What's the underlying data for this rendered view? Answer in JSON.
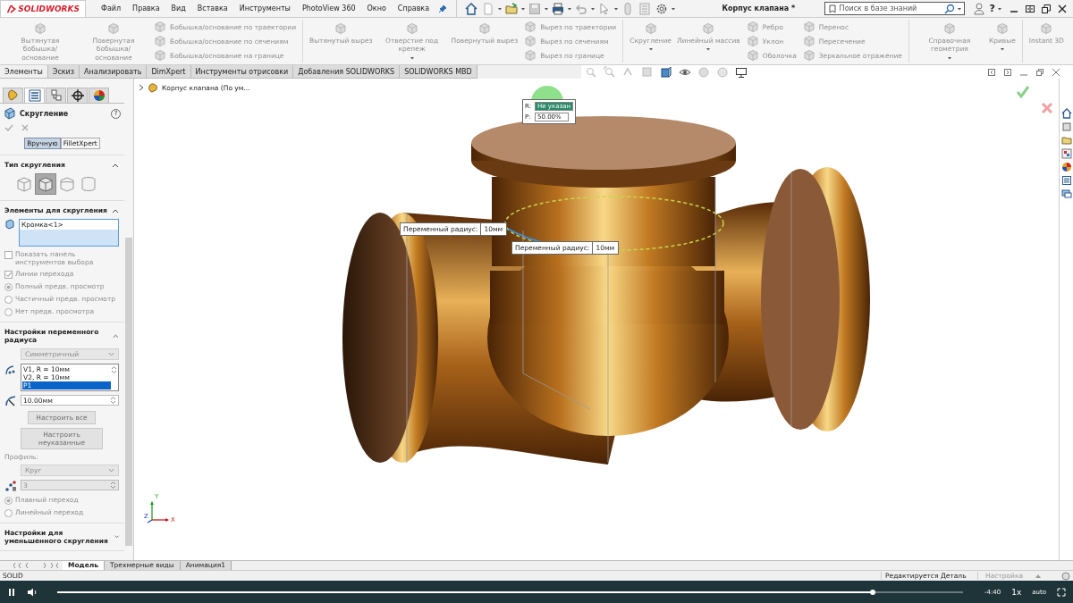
{
  "app": {
    "logo": "SOLIDWORKS",
    "menu": [
      "Файл",
      "Правка",
      "Вид",
      "Вставка",
      "Инструменты",
      "PhotoView 360",
      "Окно",
      "Справка"
    ],
    "quick_access": [
      {
        "kind": "home",
        "dropdown": false
      },
      {
        "kind": "new",
        "dropdown": true
      },
      {
        "kind": "open",
        "dropdown": true
      },
      {
        "kind": "save",
        "dropdown": true
      },
      {
        "kind": "print",
        "dropdown": true
      },
      {
        "kind": "undo",
        "dropdown": true
      },
      {
        "kind": "select",
        "dropdown": true
      },
      {
        "kind": "rebuild",
        "dropdown": false
      },
      {
        "kind": "properties",
        "dropdown": false
      },
      {
        "kind": "options",
        "dropdown": true
      }
    ],
    "title": "Корпус клапана *",
    "search": {
      "placeholder": "Поиск в базе знаний"
    },
    "help": "?"
  },
  "ribbon": [
    {
      "kind": "large",
      "label": "Вытянутая бобышка/основание",
      "disabled": true,
      "dropdown": false
    },
    {
      "kind": "large",
      "label": "Повернутая бобышка/основание",
      "disabled": true,
      "dropdown": false
    },
    {
      "kind": "stack",
      "disabled": true,
      "labels": [
        "Бобышка/основание по траектории",
        "Бобышка/основание по сечениям",
        "Бобышка/основание на границе"
      ]
    },
    {
      "kind": "divider"
    },
    {
      "kind": "large",
      "label": "Вытянутый вырез",
      "disabled": true,
      "dropdown": false
    },
    {
      "kind": "large",
      "label": "Отверстие под крепеж",
      "disabled": true,
      "dropdown": true
    },
    {
      "kind": "large",
      "label": "Повернутый вырез",
      "disabled": true,
      "dropdown": false
    },
    {
      "kind": "stack",
      "disabled": true,
      "labels": [
        "Вырез по траектории",
        "Вырез по сечениям",
        "Вырез по границе"
      ]
    },
    {
      "kind": "divider"
    },
    {
      "kind": "large",
      "label": "Скругление",
      "disabled": true,
      "dropdown": true
    },
    {
      "kind": "large",
      "label": "Линейный массив",
      "disabled": true,
      "dropdown": true
    },
    {
      "kind": "stack",
      "disabled": true,
      "labels": [
        "Ребро",
        "Уклон",
        "Оболочка"
      ]
    },
    {
      "kind": "stack",
      "disabled": true,
      "labels": [
        "Перенос",
        "Пересечение",
        "Зеркальное отражение"
      ]
    },
    {
      "kind": "divider"
    },
    {
      "kind": "large",
      "label": "Справочная геометрия",
      "disabled": true,
      "dropdown": true
    },
    {
      "kind": "large",
      "label": "Кривые",
      "disabled": true,
      "dropdown": true
    },
    {
      "kind": "divider"
    },
    {
      "kind": "large",
      "label": "Instant 3D",
      "disabled": true,
      "dropdown": false
    }
  ],
  "command_tabs": [
    {
      "label": "Элементы",
      "selected": true
    },
    {
      "label": "Эскиз",
      "selected": false
    },
    {
      "label": "Анализировать",
      "selected": false
    },
    {
      "label": "DimXpert",
      "selected": false
    },
    {
      "label": "Инструменты отрисовки",
      "selected": false
    },
    {
      "label": "Добавления SOLIDWORKS",
      "selected": false
    },
    {
      "label": "SOLIDWORKS MBD",
      "selected": false
    }
  ],
  "panel": {
    "tabs": [
      {
        "kind": "feature-tree",
        "selected": false
      },
      {
        "kind": "property-manager",
        "selected": true
      },
      {
        "kind": "configuration",
        "selected": false
      },
      {
        "kind": "dimxpert",
        "selected": false
      },
      {
        "kind": "display",
        "selected": false
      }
    ],
    "title": "Скругление",
    "help": "?",
    "modes": [
      {
        "label": "Вручную",
        "selected": true
      },
      {
        "label": "FilletXpert",
        "selected": false
      }
    ],
    "sections": [
      {
        "title": "Тип скругления",
        "expanded": true,
        "rows": [
          {
            "kind": "type-icons",
            "items": [
              {
                "kind": "constant",
                "selected": false
              },
              {
                "kind": "variable",
                "selected": true
              },
              {
                "kind": "face",
                "selected": false
              },
              {
                "kind": "full",
                "selected": false
              }
            ]
          }
        ]
      },
      {
        "title": "Элементы для скругления",
        "expanded": true,
        "rows": [
          {
            "kind": "selection-list",
            "items": [
              "Кромка<1>"
            ]
          },
          {
            "kind": "checkbox",
            "label": "Показать панель инструментов выбора",
            "checked": false,
            "disabled": true
          },
          {
            "kind": "checkbox",
            "label": "Линии перехода",
            "checked": true,
            "disabled": true
          },
          {
            "kind": "radio",
            "label": "Полный предв. просмотр",
            "selected": true,
            "disabled": true
          },
          {
            "kind": "radio",
            "label": "Частичный предв. просмотр",
            "selected": false,
            "disabled": true
          },
          {
            "kind": "radio",
            "label": "Нет предв. просмотра",
            "selected": false,
            "disabled": true
          }
        ]
      },
      {
        "title": "Настройки переменного радиуса",
        "expanded": true,
        "rows": [
          {
            "kind": "dropdown",
            "value": "Симметричный",
            "disabled": true
          },
          {
            "kind": "value-list",
            "items": [
              {
                "label": "V1, R = 10мм",
                "selected": false
              },
              {
                "label": "V2, R = 10мм",
                "selected": false
              },
              {
                "label": "P1",
                "selected": true
              }
            ]
          },
          {
            "kind": "spin",
            "value": "10.00мм",
            "disabled": false
          },
          {
            "kind": "button",
            "label": "Настроить все",
            "disabled": true
          },
          {
            "kind": "button",
            "label": "Настроить неуказанные",
            "disabled": true
          },
          {
            "kind": "label",
            "text": "Профиль:",
            "disabled": true
          },
          {
            "kind": "dropdown",
            "value": "Круг",
            "disabled": true
          },
          {
            "kind": "spin",
            "value": "3",
            "disabled": true
          },
          {
            "kind": "radio",
            "label": "Плавный переход",
            "selected": true,
            "disabled": true
          },
          {
            "kind": "radio",
            "label": "Линейный переход",
            "selected": false,
            "disabled": true
          }
        ]
      },
      {
        "title": "Настройки для уменьшенного скругления",
        "expanded": false
      }
    ]
  },
  "viewport": {
    "tree_root": "Корпус клапана  (По ум...",
    "radius_callouts": [
      {
        "label": "Переменный радиус:",
        "value": "10мм"
      },
      {
        "label": "Переменный радиус:",
        "value": "10мм"
      }
    ],
    "point_callout": {
      "r_label": "R:",
      "r_value": "Не указан",
      "p_label": "P:",
      "p_value": "50.00%"
    },
    "triad": {
      "x": "X",
      "y": "Y",
      "z": "Z"
    }
  },
  "document_tabs": [
    {
      "label": "Модель",
      "selected": true
    },
    {
      "label": "Трехмерные виды",
      "selected": false
    },
    {
      "label": "Анимация1",
      "selected": false
    }
  ],
  "status_bar": {
    "left": "SOLID",
    "mode": "Редактируется Деталь",
    "units": "Настройка"
  },
  "player": {
    "playing": true,
    "level": 0.9,
    "time": "-4:40",
    "speed": "1x",
    "quality": "auto"
  }
}
